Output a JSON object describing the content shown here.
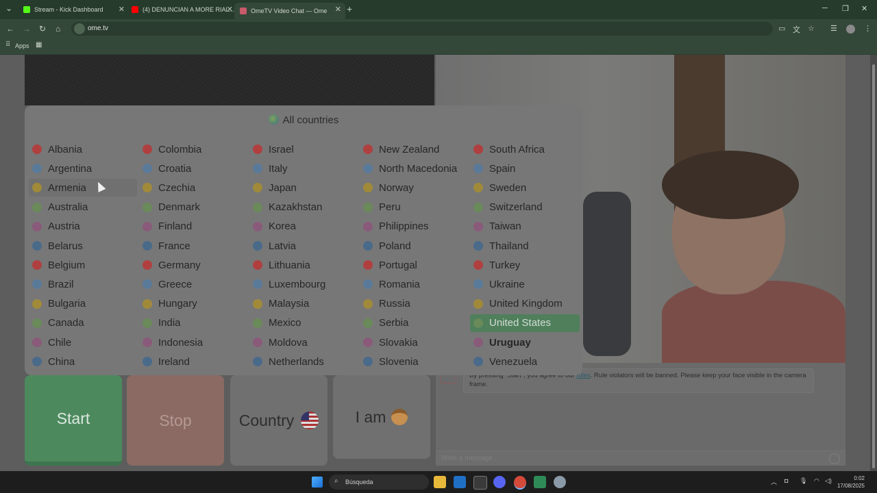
{
  "browser": {
    "tabs": [
      {
        "title": "Stream - Kick Dashboard",
        "favicon_color": "#53fc18"
      },
      {
        "title": "(4) DENUNCIAN A MORE RIAL...",
        "favicon_color": "#ff0000"
      },
      {
        "title": "OmeTV Video Chat — Ome",
        "favicon_color": "#c85a6a"
      }
    ],
    "new_tab_label": "+",
    "url": "ome.tv",
    "bookmarks": {
      "apps_label": "Apps"
    }
  },
  "country_panel": {
    "title": "All countries",
    "countries": [
      [
        "Albania",
        "Argentina",
        "Armenia",
        "Australia",
        "Austria",
        "Belarus",
        "Belgium",
        "Brazil",
        "Bulgaria",
        "Canada",
        "Chile",
        "China"
      ],
      [
        "Colombia",
        "Croatia",
        "Czechia",
        "Denmark",
        "Finland",
        "France",
        "Germany",
        "Greece",
        "Hungary",
        "India",
        "Indonesia",
        "Ireland"
      ],
      [
        "Israel",
        "Italy",
        "Japan",
        "Kazakhstan",
        "Korea",
        "Latvia",
        "Lithuania",
        "Luxembourg",
        "Malaysia",
        "Mexico",
        "Moldova",
        "Netherlands"
      ],
      [
        "New Zealand",
        "North Macedonia",
        "Norway",
        "Peru",
        "Philippines",
        "Poland",
        "Portugal",
        "Romania",
        "Russia",
        "Serbia",
        "Slovakia",
        "Slovenia"
      ],
      [
        "South Africa",
        "Spain",
        "Sweden",
        "Switzerland",
        "Taiwan",
        "Thailand",
        "Turkey",
        "Ukraine",
        "United Kingdom",
        "United States",
        "Uruguay",
        "Venezuela"
      ]
    ],
    "hovered": "Armenia",
    "selected": "United States",
    "highlighted_bold": "Uruguay"
  },
  "controls": {
    "start_label": "Start",
    "stop_label": "Stop",
    "country_label": "Country",
    "iam_label": "I am"
  },
  "chat": {
    "notice_before": "By pressing \"Start\", you agree to our ",
    "notice_link": "rules",
    "notice_after": ". Rule violators will be banned. Please keep your face visible in the camera frame.",
    "input_placeholder": "Write a message..."
  },
  "taskbar": {
    "search_label": "Búsqueda",
    "time": "0:02",
    "date": "17/08/2025"
  },
  "colors": {
    "accent_green": "#4f7f5b",
    "start_green": "#4c8a5e",
    "stop_red": "#8a6a63"
  }
}
